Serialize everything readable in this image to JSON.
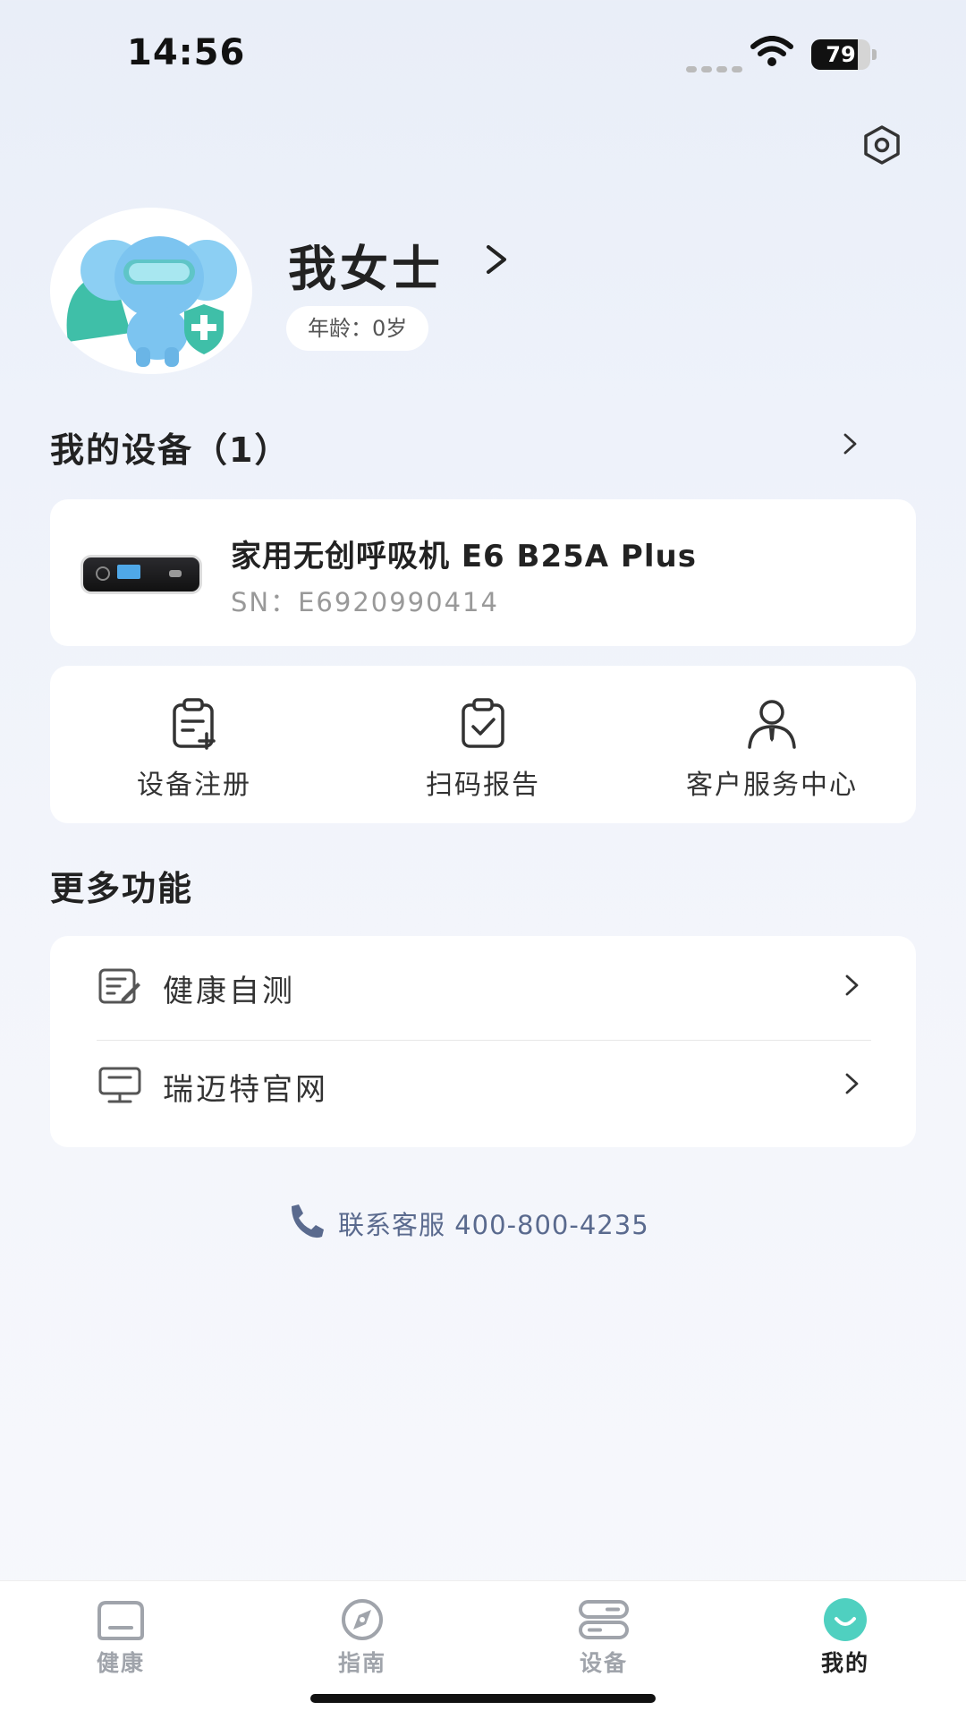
{
  "status_bar": {
    "time": "14:56",
    "battery_level": "79",
    "battery_fraction": 0.79
  },
  "icons": {
    "settings": "settings-hexagon-icon",
    "profile_arrow": "chevron-right-icon",
    "device_register": "clipboard-plus-icon",
    "scan_report": "clipboard-check-icon",
    "customer_service": "user-tie-icon",
    "health_test": "edit-document-icon",
    "website": "monitor-icon",
    "phone": "phone-icon",
    "tab_health": "home-icon",
    "tab_guide": "compass-icon",
    "tab_device": "device-toggle-icon",
    "tab_mine": "smile-circle-icon"
  },
  "profile": {
    "name": "我女士",
    "arrow": ">",
    "age_label": "年龄：0岁"
  },
  "my_devices": {
    "title": "我的设备（1）",
    "device": {
      "name": "家用无创呼吸机 E6 B25A Plus",
      "sn": "SN：E6920990414"
    }
  },
  "quick_actions": [
    {
      "label": "设备注册"
    },
    {
      "label": "扫码报告"
    },
    {
      "label": "客户服务中心"
    }
  ],
  "more_functions": {
    "title": "更多功能",
    "items": [
      {
        "label": "健康自测"
      },
      {
        "label": "瑞迈特官网"
      }
    ]
  },
  "contact": {
    "text": "联系客服 400-800-4235"
  },
  "tabbar": {
    "tabs": [
      {
        "label": "健康"
      },
      {
        "label": "指南"
      },
      {
        "label": "设备"
      },
      {
        "label": "我的"
      }
    ],
    "active_index": 3
  },
  "colors": {
    "accent": "#4fd0c0",
    "contact_text": "#5a6a8e",
    "tab_inactive": "#a0a4ab",
    "tab_active": "#222222"
  }
}
